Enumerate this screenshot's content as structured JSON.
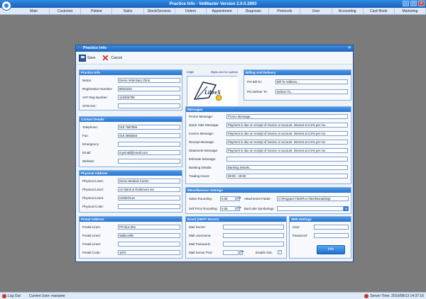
{
  "app": {
    "title": "Practice Info - VetMaster Version 2.0.0.2693",
    "minimize": "–",
    "maximize": "□",
    "close": "×"
  },
  "menu": [
    "Main",
    "Customer",
    "Patient",
    "Sales",
    "Stock/Services",
    "Orders",
    "Appointment",
    "Diagnosis",
    "Protocols",
    "User",
    "Accounting",
    "Cash Book",
    "Marketing"
  ],
  "status": {
    "logout": "Log Out",
    "current_user": "Current User: mariame",
    "server_time": "Server Time: 2010/08/13 14:37:16"
  },
  "dialog": {
    "title": "Practice Info",
    "close": "×",
    "save_label": "Save",
    "cancel_label": "Cancel"
  },
  "practice_info": {
    "header": "Practice Info",
    "name_label": "Name:",
    "name": "Demo Veterinary Clinic",
    "reg_label": "Registration Number:",
    "reg": "88/22222",
    "vat_label": "VAT Reg Number:",
    "vat": "123456789",
    "sitb_label": "SITB NO.:",
    "sitb": ""
  },
  "contact": {
    "header": "Contact Details",
    "tel_label": "Telephone:",
    "tel": "018 7687555",
    "fax_label": "Fax:",
    "fax": "018 3655556",
    "emerg_label": "Emergency:",
    "emerg": "",
    "email_label": "Email:",
    "email": "myemail@email.com",
    "web_label": "Website:",
    "web": ""
  },
  "physical": {
    "header": "Physical Address",
    "l1_label": "Physical Line1:",
    "l1": "Demo Medical Centre",
    "l2_label": "Physical Line2:",
    "l2": "cnr Bank & Rushmore sts",
    "l3_label": "Physical Line3:",
    "l3": "Helderkruin",
    "code_label": "Physical Code:",
    "code": ""
  },
  "postal": {
    "header": "Postal Address",
    "l1_label": "Postal Line1:",
    "l1": "PO Box 551",
    "l2_label": "Postal Line2:",
    "l2": "Walkerville",
    "l3_label": "Postal Line3:",
    "l3": "",
    "code_label": "Postal Code:",
    "code": "1876"
  },
  "logo": {
    "label": "Logo",
    "hint": "Right-click for options",
    "brand": "LibreX"
  },
  "billing": {
    "header": "Billing And Delivery",
    "bill_label": "PO Bill To:",
    "bill": "Bill To Address...",
    "deliver_label": "PO Deliver To:",
    "deliver": "Deliver To..."
  },
  "messages": {
    "header": "Messages",
    "promo_label": "Promo Message:",
    "promo": "Promo Message...",
    "quick_label": "Quick Sale Message:",
    "quick": "Payment is due on receipt of invoice or account. Interest at 2.5% per mo",
    "invoice_label": "Invoice Message:",
    "invoice": "Payment is due on receipt of invoice or account. Interest at 2.5% per mo",
    "receipt_label": "Receipt Message:",
    "receipt": "Payment is due on receipt of invoice or account. Interest at 2.5% per mo",
    "statement_label": "Statement Message:",
    "statement": "Payment is due on receipt of invoice or account. Interest at 2.5% per mo",
    "estimate_label": "Estimate Message:",
    "estimate": "",
    "banking_label": "Banking Details:",
    "banking": "Banking Details...",
    "hours_label": "Trading Hours:",
    "hours": "08:00 - 18:00"
  },
  "misc": {
    "header": "Miscellaneous Settings",
    "sales_round_label": "Sales Rounding:",
    "sales_round": "0.05",
    "sell_round_label": "Sell Price Rounding:",
    "sell_round": "0.05",
    "attach_label": "Attachment Folder:",
    "attach": "C:\\Program Files\\Pro Files\\Remarking\\",
    "barcode_label": "BarCode Symbology:",
    "barcode": ""
  },
  "email_server": {
    "header": "Email (SMTP Server)",
    "server_label": "Mail Server:",
    "server": "",
    "user_label": "Mail Username:",
    "user": "",
    "pass_label": "Mail Password:",
    "pass": "",
    "port_label": "Mail Server Port:",
    "port": "",
    "ssl_label": "Enable SSL",
    "ssl_check": "✓"
  },
  "sms": {
    "header": "SMS Settings",
    "user_label": "User:",
    "user": "",
    "pass_label": "Password:",
    "pass": "",
    "info_label": "Info"
  }
}
